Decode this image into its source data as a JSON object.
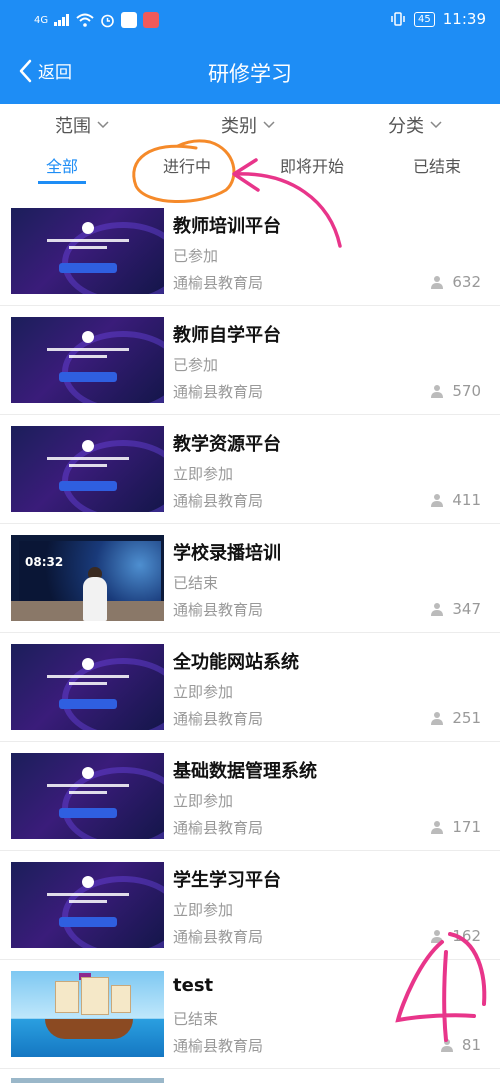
{
  "status_bar": {
    "network": "4G",
    "time": "11:39",
    "battery": "45"
  },
  "nav": {
    "back_label": "返回",
    "title": "研修学习"
  },
  "filters": [
    {
      "label": "范围"
    },
    {
      "label": "类别"
    },
    {
      "label": "分类"
    }
  ],
  "tabs": [
    {
      "label": "全部",
      "active": true
    },
    {
      "label": "进行中",
      "active": false
    },
    {
      "label": "即将开始",
      "active": false
    },
    {
      "label": "已结束",
      "active": false
    }
  ],
  "items": [
    {
      "title": "教师培训平台",
      "status": "已参加",
      "org": "通榆县教育局",
      "count": "632"
    },
    {
      "title": "教师自学平台",
      "status": "已参加",
      "org": "通榆县教育局",
      "count": "570"
    },
    {
      "title": "教学资源平台",
      "status": "立即参加",
      "org": "通榆县教育局",
      "count": "411"
    },
    {
      "title": "学校录播培训",
      "status": "已结束",
      "org": "通榆县教育局",
      "count": "347"
    },
    {
      "title": "全功能网站系统",
      "status": "立即参加",
      "org": "通榆县教育局",
      "count": "251"
    },
    {
      "title": "基础数据管理系统",
      "status": "立即参加",
      "org": "通榆县教育局",
      "count": "171"
    },
    {
      "title": "学生学习平台",
      "status": "立即参加",
      "org": "通榆县教育局",
      "count": "162"
    },
    {
      "title": "test",
      "status": "已结束",
      "org": "通榆县教育局",
      "count": "81"
    }
  ],
  "thumbnails": {
    "video_clock": "08:32"
  },
  "colors": {
    "accent": "#1e8df5",
    "annotation": "#e8358a",
    "annotation_circle": "#f58a2a"
  },
  "icons": {
    "back": "chevron-left-icon",
    "dropdown": "chevron-down-icon",
    "participants": "person-icon"
  }
}
